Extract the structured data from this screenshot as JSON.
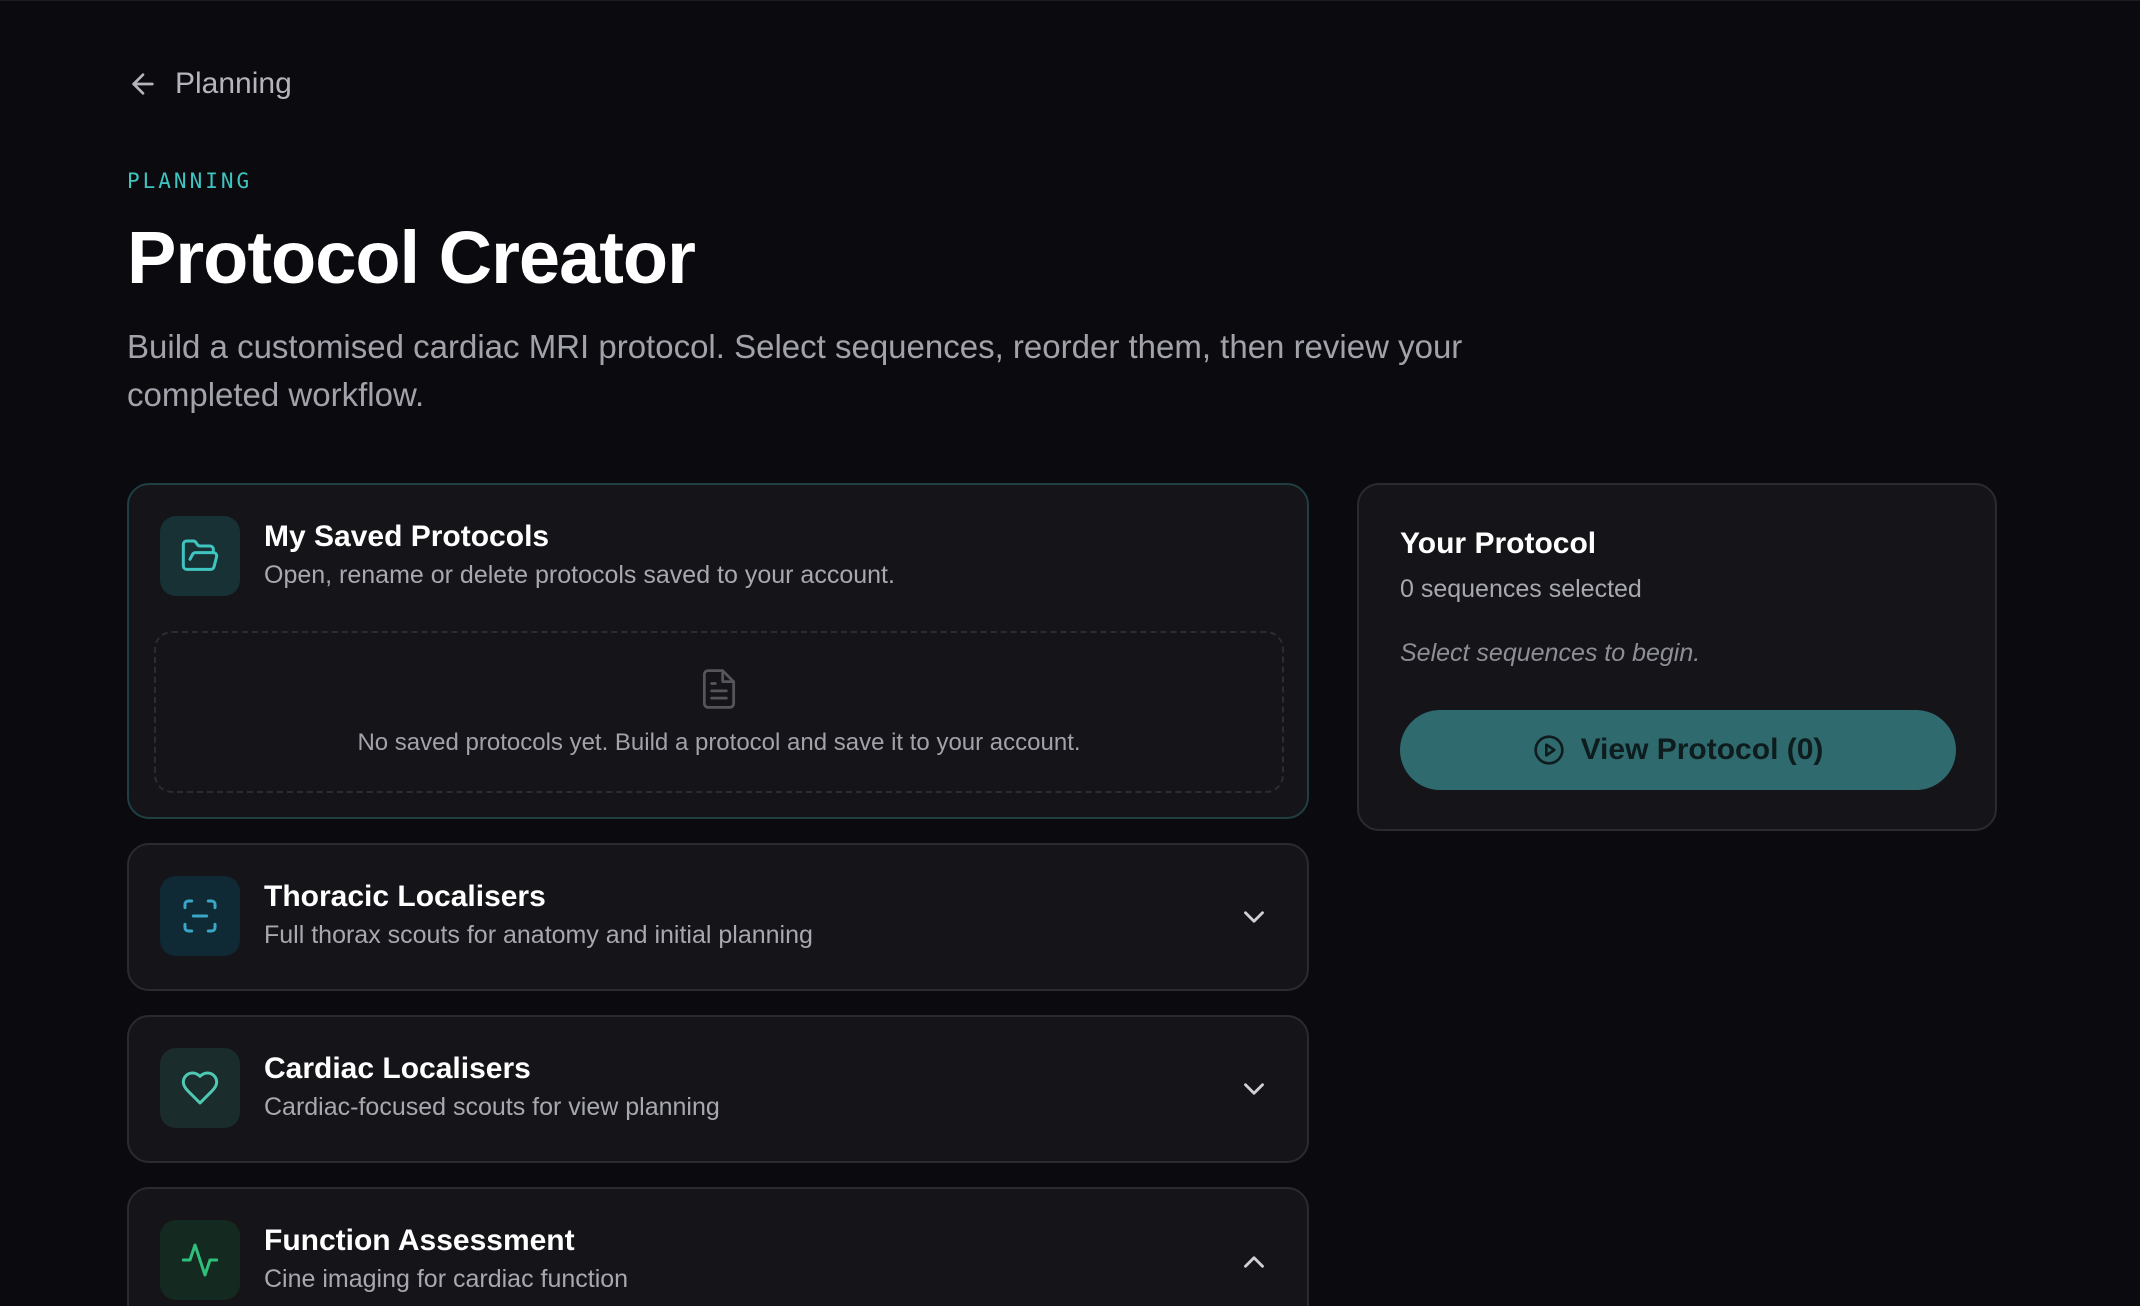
{
  "nav": {
    "back_label": "Planning"
  },
  "header": {
    "eyebrow": "PLANNING",
    "title": "Protocol Creator",
    "subtitle": "Build a customised cardiac MRI protocol. Select sequences, reorder them, then review your completed workflow."
  },
  "saved": {
    "title": "My Saved Protocols",
    "description": "Open, rename or delete protocols saved to your account.",
    "empty_text": "No saved protocols yet. Build a protocol and save it to your account.",
    "icon": "folder-open-icon"
  },
  "sections": [
    {
      "title": "Thoracic Localisers",
      "description": "Full thorax scouts for anatomy and initial planning",
      "icon": "scan-icon",
      "expanded": false
    },
    {
      "title": "Cardiac Localisers",
      "description": "Cardiac-focused scouts for view planning",
      "icon": "heart-icon",
      "expanded": false
    },
    {
      "title": "Function Assessment",
      "description": "Cine imaging for cardiac function",
      "icon": "activity-icon",
      "expanded": true
    }
  ],
  "protocol": {
    "title": "Your Protocol",
    "count_text": "0 sequences selected",
    "hint": "Select sequences to begin.",
    "view_button_label": "View Protocol (0)"
  },
  "colors": {
    "background": "#0b0b0f",
    "card": "#141419",
    "accent": "#3fc4c0",
    "button": "#2f6b6e"
  }
}
